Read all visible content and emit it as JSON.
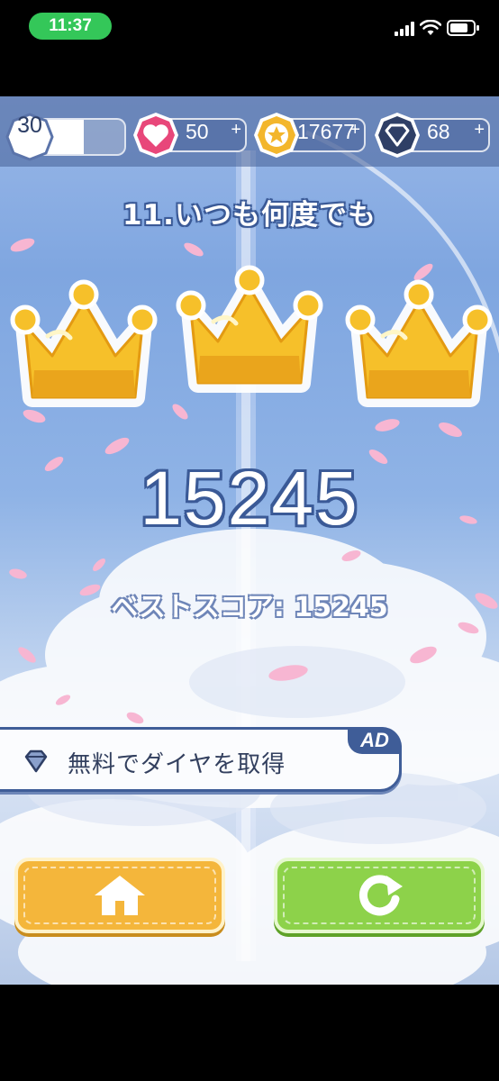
{
  "status_bar": {
    "time": "11:37",
    "signal_icon": "cellular-signal-icon",
    "wifi_icon": "wifi-icon",
    "battery_icon": "battery-icon",
    "battery_level": 0.8
  },
  "hud": {
    "level": "30",
    "level_progress": 0.62,
    "lives": "50",
    "coins": "17677",
    "diamonds": "68",
    "plus_label": "+",
    "lives_icon": "heart-icon",
    "coins_icon": "star-coin-icon",
    "diamonds_icon": "diamond-icon"
  },
  "result": {
    "song_title": "11.いつも何度でも",
    "crowns_earned": 3,
    "crown_icon": "crown-icon",
    "score": "15245",
    "best_score_text": "ベストスコア: 15245"
  },
  "ad_offer": {
    "label": "無料でダイヤを取得",
    "badge": "AD",
    "icon": "diamond-icon"
  },
  "buttons": {
    "home_icon": "home-icon",
    "replay_icon": "replay-icon"
  },
  "colors": {
    "accent_navy": "#3f5d98",
    "home_button": "#f4b63b",
    "replay_button": "#8dd24a",
    "crown_gold": "#f6c02a",
    "heart_pink": "#e8477a"
  }
}
